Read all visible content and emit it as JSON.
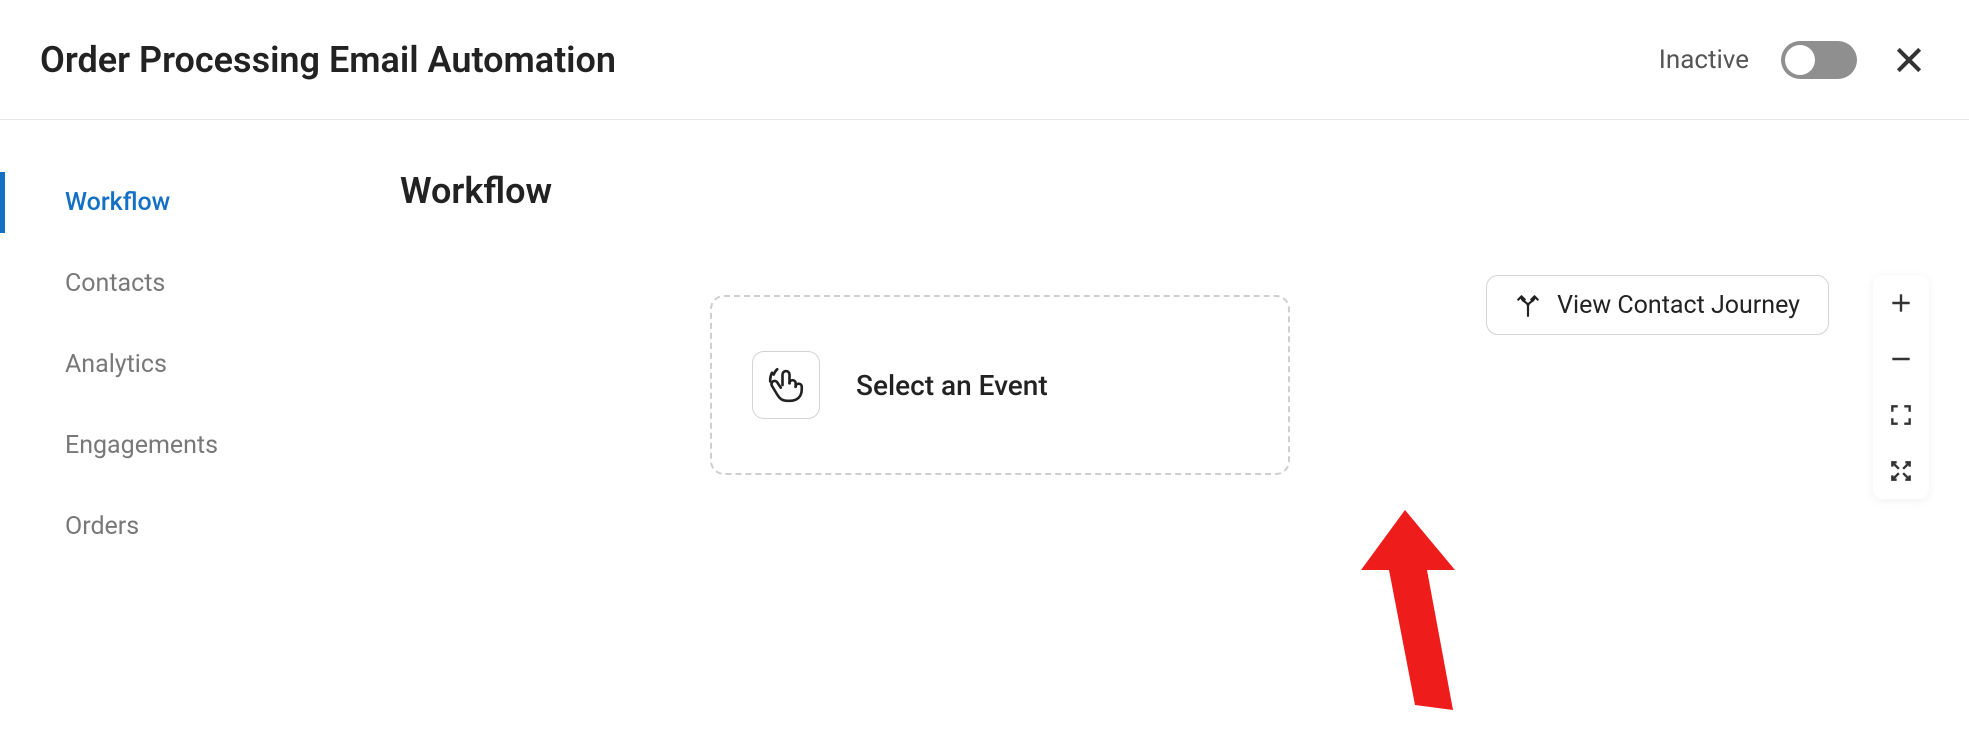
{
  "header": {
    "title": "Order Processing Email Automation",
    "status_label": "Inactive",
    "active": false
  },
  "sidebar": {
    "items": [
      {
        "label": "Workflow",
        "active": true
      },
      {
        "label": "Contacts",
        "active": false
      },
      {
        "label": "Analytics",
        "active": false
      },
      {
        "label": "Engagements",
        "active": false
      },
      {
        "label": "Orders",
        "active": false
      }
    ]
  },
  "main": {
    "title": "Workflow",
    "event_card": {
      "label": "Select an Event",
      "icon": "tap-gesture-icon"
    },
    "journey_button": {
      "label": "View Contact Journey",
      "icon": "fork-arrow-icon"
    },
    "zoom": {
      "in": "+",
      "out": "−"
    }
  }
}
